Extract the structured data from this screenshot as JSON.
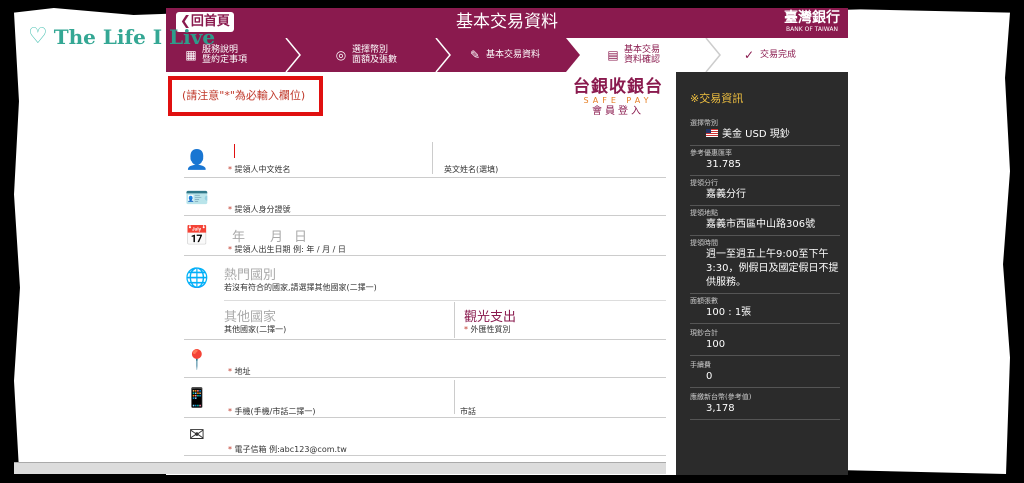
{
  "header": {
    "back_label": "回首頁",
    "title": "基本交易資料",
    "bank_name": "臺灣銀行",
    "bank_name_en": "BANK OF TAIWAN",
    "color": "#8a1a4e"
  },
  "steps": [
    {
      "label_1": "服務說明",
      "label_2": "暨約定事項",
      "icon": "grid-icon"
    },
    {
      "label_1": "選擇幣別",
      "label_2": "面額及張數",
      "icon": "coins-icon"
    },
    {
      "label_1": "基本交易資料",
      "label_2": "",
      "icon": "edit-icon"
    },
    {
      "label_1": "基本交易",
      "label_2": "資料確認",
      "icon": "confirm-icon"
    },
    {
      "label_1": "交易完成",
      "label_2": "",
      "icon": "check-icon"
    }
  ],
  "form": {
    "notice": "(請注意\"*\"為必輸入欄位)",
    "safepay_logo": "台銀收銀台",
    "safepay_en": "SAFE PAY",
    "safepay_login": "會員登入",
    "name_zh_label": "提領人中文姓名",
    "name_en_label": "英文姓名(選填)",
    "id_label": "提領人身分證號",
    "dob_label": "提領人出生日期 例: 年 / 月 / 日",
    "dob_year": "年",
    "dob_month": "月",
    "dob_day": "日",
    "hot_country_placeholder": "熱門國別",
    "hot_country_hint": "若沒有符合的國家,請選擇其他國家(二擇一)",
    "other_country_placeholder": "其他國家",
    "other_country_label": "其他國家(二擇一)",
    "purpose_value": "觀光支出",
    "purpose_label": "外匯性質別",
    "address_label": "地址",
    "mobile_label": "手機(手機/市話二擇一)",
    "phone_label": "市話",
    "email_label": "電子信箱 例:abc123@com.tw",
    "req_mark": "*"
  },
  "panel": {
    "title": "※交易資訊",
    "items": [
      {
        "key": "選擇幣別",
        "value": "美金 USD 現鈔"
      },
      {
        "key": "參考優惠匯率",
        "value": "31.785"
      },
      {
        "key": "提領分行",
        "value": "嘉義分行"
      },
      {
        "key": "提領地點",
        "value": "嘉義市西區中山路306號"
      },
      {
        "key": "提領時間",
        "value": "週一至週五上午9:00至下午3:30，例假日及國定假日不提供服務。"
      },
      {
        "key": "面額張數",
        "value": "100 : 1張"
      },
      {
        "key": "現鈔合計",
        "value": "100"
      },
      {
        "key": "手續費",
        "value": "0"
      },
      {
        "key": "應繳新台幣(參考值)",
        "value": "3,178"
      }
    ]
  },
  "watermark": {
    "text": "The Life I Live",
    "icon": "heart-icon"
  }
}
